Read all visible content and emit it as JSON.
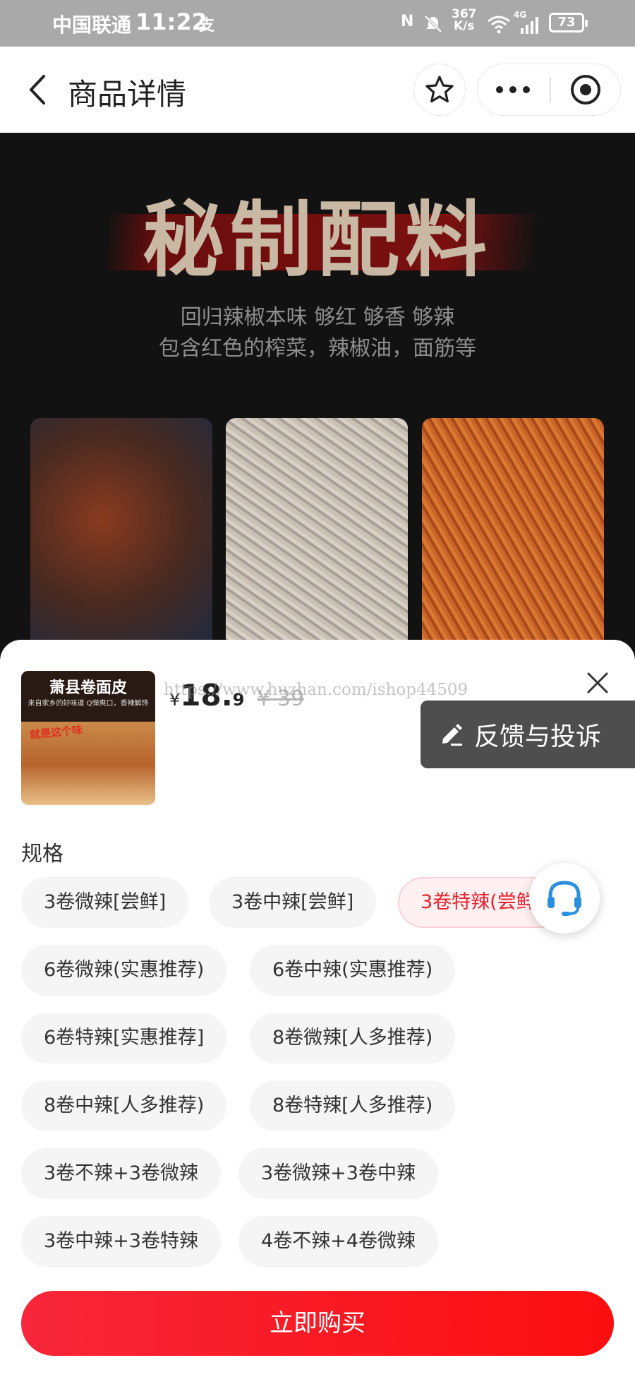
{
  "status_bar": {
    "carrier": "中国联通",
    "time": "11:22",
    "extra_icon": "支",
    "nfc": "N",
    "network_speed_value": "367",
    "network_speed_unit": "K/s",
    "network_type": "4G",
    "battery": "73"
  },
  "header": {
    "title": "商品详情"
  },
  "hero": {
    "title": "秘制配料",
    "subtitle_line1": "回归辣椒本味 够红 够香 够辣",
    "subtitle_line2": "包含红色的榨菜，辣椒油，面筋等"
  },
  "product": {
    "thumb_title": "萧县卷面皮",
    "thumb_subtitle": "来自家乡的好味道 Q弹爽口，香辣解馋",
    "thumb_tag": "就是这个味",
    "price_symbol": "¥",
    "price_integer": "18.",
    "price_decimal": "9",
    "original_price": "¥ 39",
    "watermark": "https://www.huzhan.com/ishop44509"
  },
  "feedback": {
    "label": "反馈与投诉"
  },
  "spec": {
    "label": "规格",
    "options": [
      "3卷微辣[尝鲜]",
      "3卷中辣[尝鲜]",
      "3卷特辣(尝鲜",
      "6卷微辣(实惠推荐)",
      "6卷中辣(实惠推荐)",
      "6卷特辣[实惠推荐]",
      "8卷微辣[人多推荐)",
      "8卷中辣[人多推荐)",
      "8卷特辣[人多推荐)",
      "3卷不辣+3卷微辣",
      "3卷微辣+3卷中辣",
      "3卷中辣+3卷特辣",
      "4卷不辣+4卷微辣"
    ],
    "selected_index": 2
  },
  "buy": {
    "label": "立即购买"
  },
  "colors": {
    "accent": "#f7263a",
    "selected_text": "#e8222e",
    "feedback_bg": "#4e4e4e",
    "service_icon": "#2b8fe0"
  }
}
